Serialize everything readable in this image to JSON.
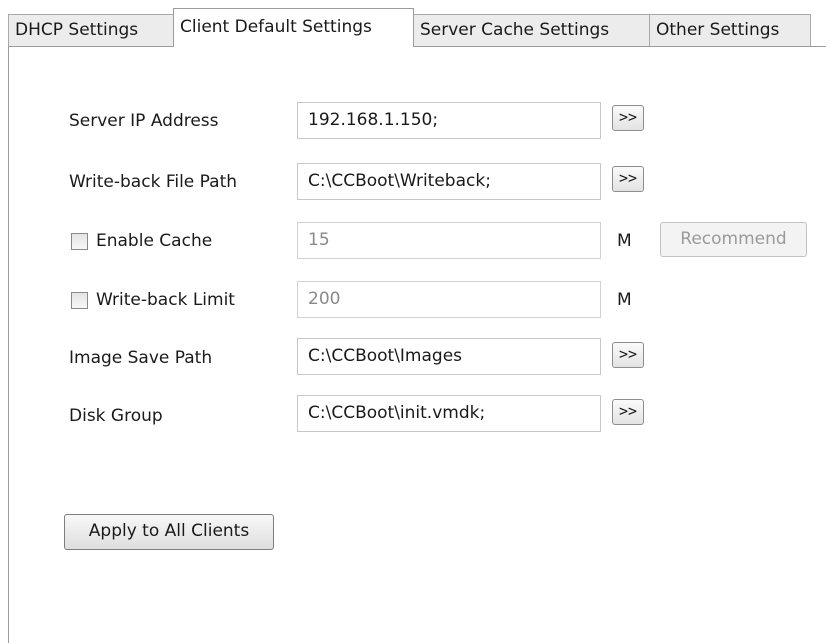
{
  "tabs": [
    {
      "label": "DHCP Settings",
      "active": false
    },
    {
      "label": "Client Default Settings",
      "active": true
    },
    {
      "label": "Server Cache Settings",
      "active": false
    },
    {
      "label": "Other Settings",
      "active": false
    }
  ],
  "form": {
    "server_ip": {
      "label": "Server IP Address",
      "value": "192.168.1.150;",
      "browse": ">>"
    },
    "writeback_path": {
      "label": "Write-back File Path",
      "value": "C:\\CCBoot\\Writeback;",
      "browse": ">>"
    },
    "enable_cache": {
      "label": "Enable Cache",
      "checked": false,
      "value": "15",
      "unit": "M",
      "recommend": "Recommend"
    },
    "writeback_limit": {
      "label": "Write-back Limit",
      "checked": false,
      "value": "200",
      "unit": "M"
    },
    "image_save_path": {
      "label": "Image Save Path",
      "value": "C:\\CCBoot\\Images",
      "browse": ">>"
    },
    "disk_group": {
      "label": "Disk Group",
      "value": "C:\\CCBoot\\init.vmdk;",
      "browse": ">>"
    }
  },
  "apply_button": "Apply to All Clients"
}
